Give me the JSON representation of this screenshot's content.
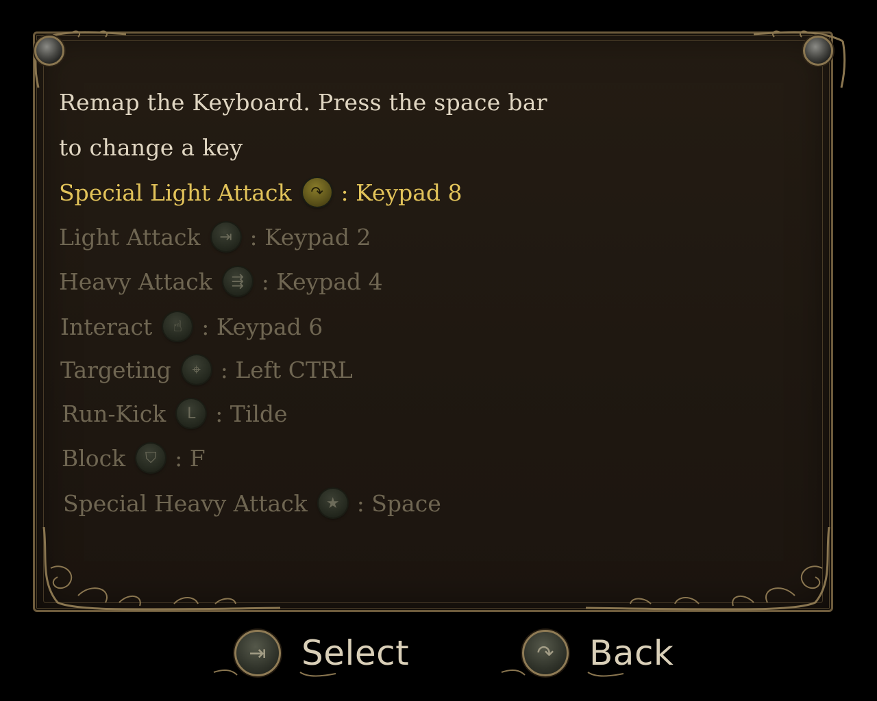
{
  "instructions": {
    "line1": "Remap the Keyboard. Press the space bar",
    "line2": "to change a key"
  },
  "bindings": [
    {
      "action": "Special Light Attack",
      "icon": "curved-arrow-icon",
      "glyph": "↷",
      "key": ": Keypad 8",
      "selected": true
    },
    {
      "action": "Light Attack",
      "icon": "sword-icon",
      "glyph": "⇥",
      "key": ": Keypad 2",
      "selected": false
    },
    {
      "action": "Heavy Attack",
      "icon": "heavy-swords-icon",
      "glyph": "⇶",
      "key": ": Keypad 4",
      "selected": false
    },
    {
      "action": "Interact",
      "icon": "hand-icon",
      "glyph": "☝",
      "key": ": Keypad 6",
      "selected": false
    },
    {
      "action": "Targeting",
      "icon": "crosshair-icon",
      "glyph": "⌖",
      "key": ": Left CTRL",
      "selected": false
    },
    {
      "action": "Run-Kick",
      "icon": "boot-icon",
      "glyph": "L",
      "key": ": Tilde",
      "selected": false
    },
    {
      "action": "Block",
      "icon": "shield-icon",
      "glyph": "⛉",
      "key": ": F",
      "selected": false
    },
    {
      "action": "Special Heavy Attack",
      "icon": "star-icon",
      "glyph": "★",
      "key": ": Space",
      "selected": false
    }
  ],
  "footer": {
    "select_label": "Select",
    "select_icon": "sword-icon",
    "select_glyph": "⇥",
    "back_label": "Back",
    "back_icon": "curved-arrow-icon",
    "back_glyph": "↷"
  },
  "colors": {
    "selected": "#e2c35a",
    "unselected": "#6f6652",
    "frame_gold": "#8a7650"
  }
}
